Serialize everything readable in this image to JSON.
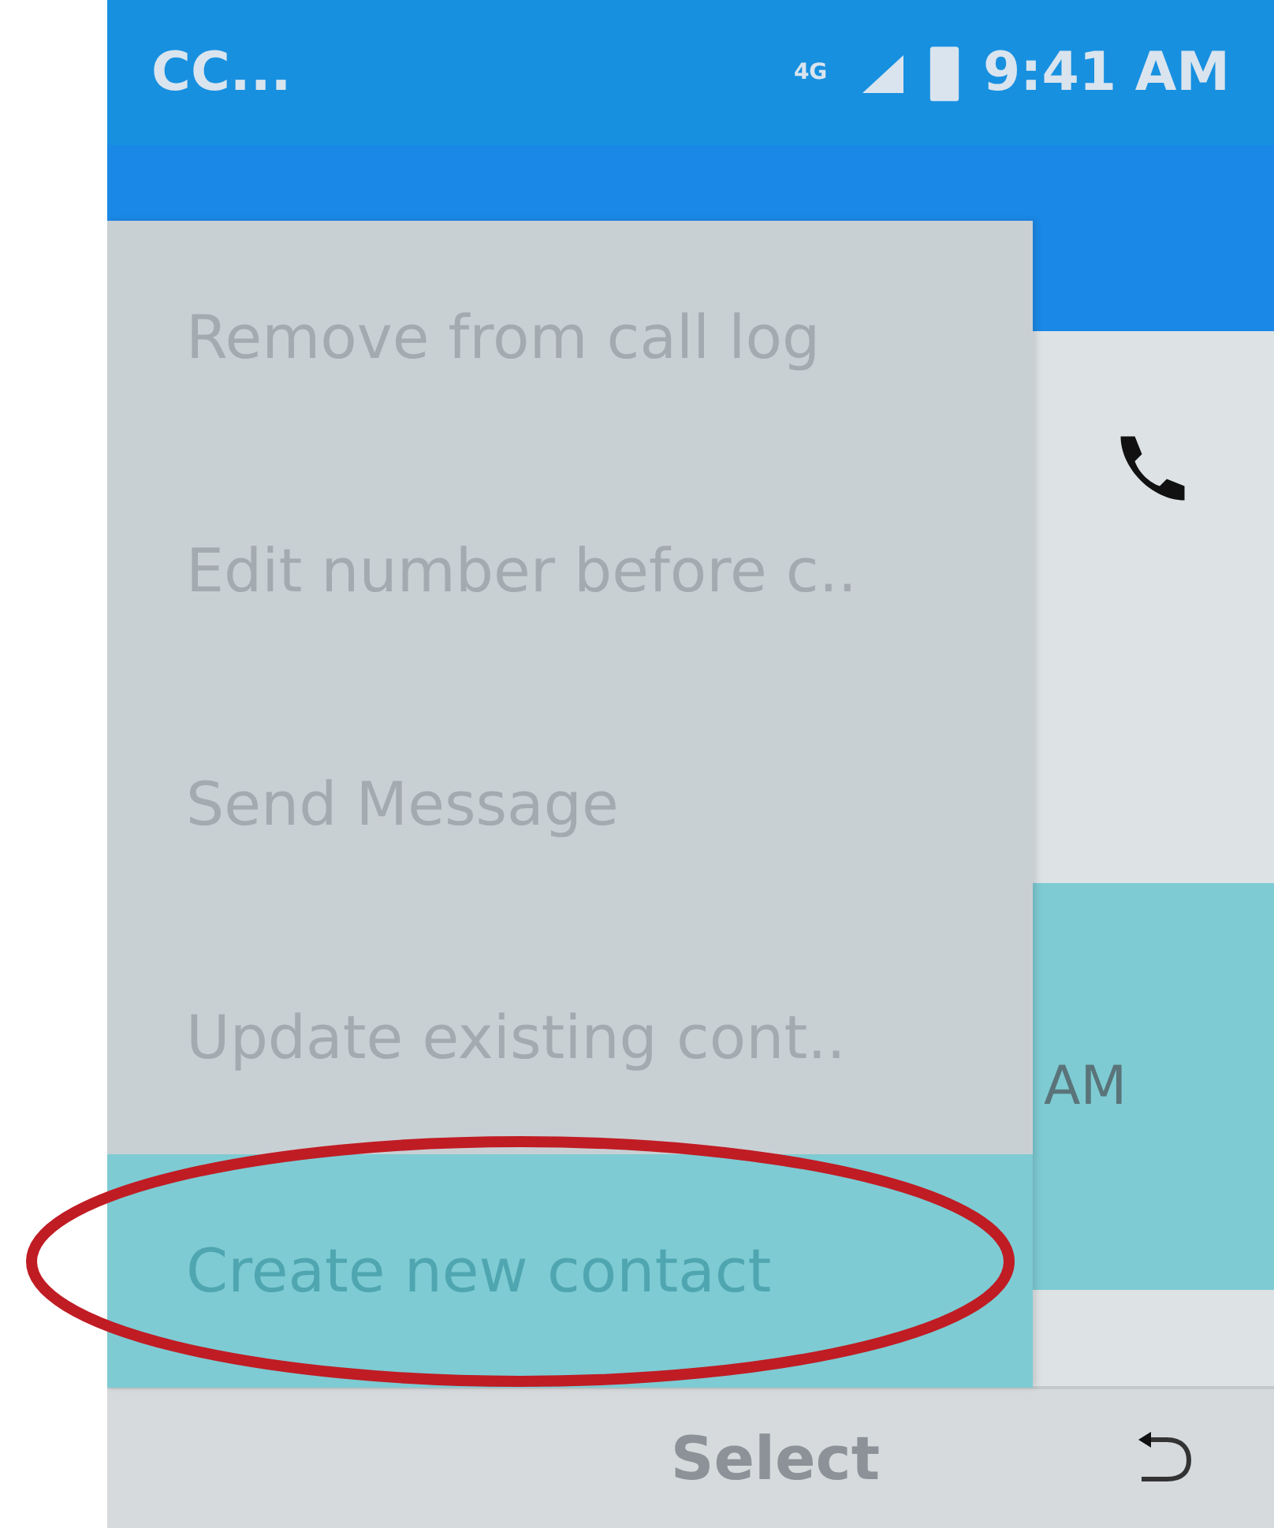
{
  "status_bar": {
    "carrier": "CC...",
    "network": "4G",
    "time": "9:41 AM"
  },
  "call_entry": {
    "time_fragment": "AM"
  },
  "menu": {
    "items": [
      {
        "label": "Remove from call log",
        "selected": false
      },
      {
        "label": "Edit number before c..",
        "selected": false
      },
      {
        "label": "Send Message",
        "selected": false
      },
      {
        "label": "Update existing cont..",
        "selected": false
      },
      {
        "label": "Create new contact",
        "selected": true
      }
    ]
  },
  "softkeys": {
    "center": "Select"
  }
}
